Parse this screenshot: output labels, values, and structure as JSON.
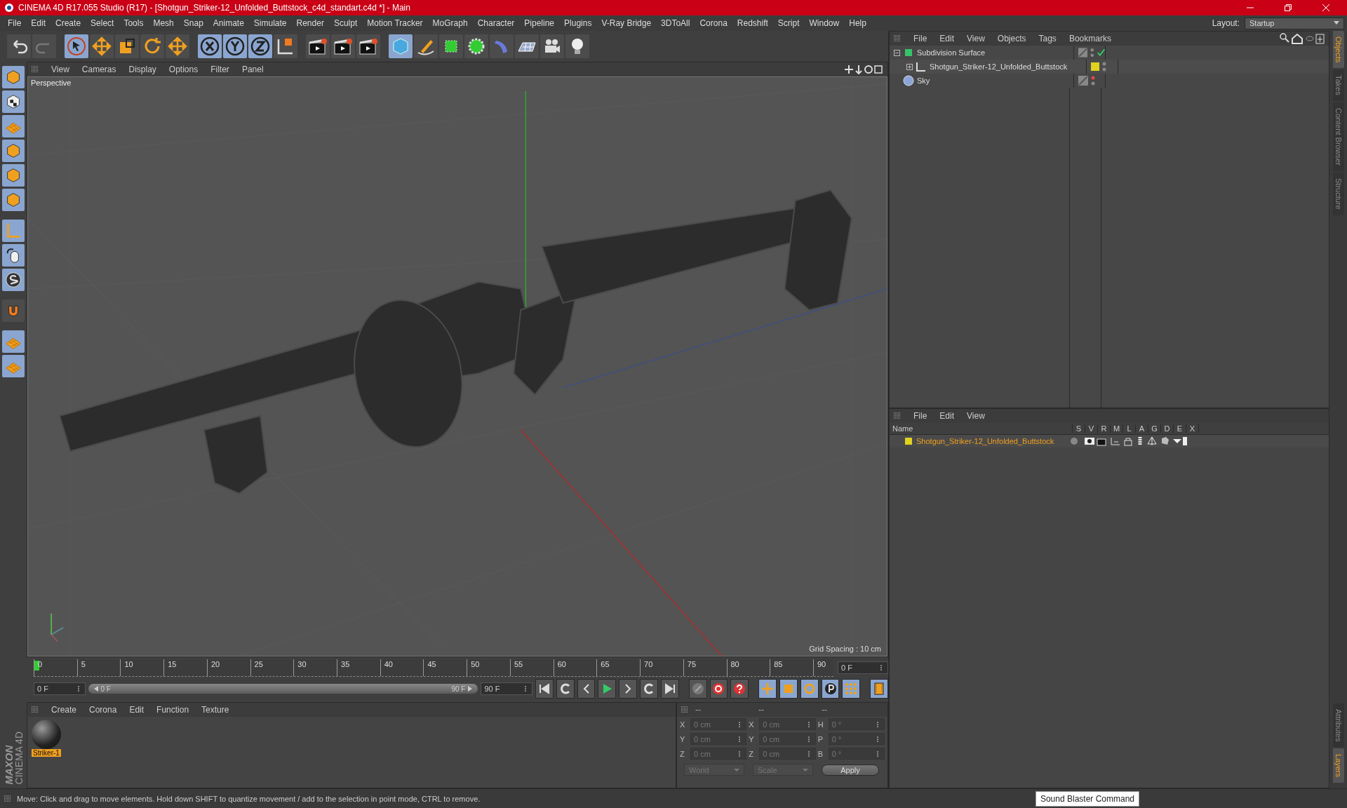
{
  "window": {
    "title": "CINEMA 4D R17.055 Studio (R17) - [Shotgun_Striker-12_Unfolded_Buttstock_c4d_standart.c4d *] - Main"
  },
  "menu": [
    "File",
    "Edit",
    "Create",
    "Select",
    "Tools",
    "Mesh",
    "Snap",
    "Animate",
    "Simulate",
    "Render",
    "Sculpt",
    "Motion Tracker",
    "MoGraph",
    "Character",
    "Pipeline",
    "Plugins",
    "V-Ray Bridge",
    "3DToAll",
    "Corona",
    "Redshift",
    "Script",
    "Window",
    "Help"
  ],
  "layout": {
    "label": "Layout:",
    "value": "Startup"
  },
  "viewport": {
    "menu": [
      "View",
      "Cameras",
      "Display",
      "Options",
      "Filter",
      "Panel"
    ],
    "camera": "Perspective",
    "grid_spacing": "Grid Spacing : 10 cm"
  },
  "timeline": {
    "ticks": [
      "0",
      "5",
      "10",
      "15",
      "20",
      "25",
      "30",
      "35",
      "40",
      "45",
      "50",
      "55",
      "60",
      "65",
      "70",
      "75",
      "80",
      "85",
      "90"
    ],
    "current_frame": "0 F",
    "start_field": "0 F",
    "range": {
      "start": "0 F",
      "end": "90 F",
      "level": 1
    },
    "end_field": "90 F"
  },
  "materials": {
    "menu": [
      "Create",
      "Corona",
      "Edit",
      "Function",
      "Texture"
    ],
    "items": [
      {
        "name": "Striker-1",
        "selected": true
      }
    ]
  },
  "coordinates": {
    "headers": [
      "--",
      "--",
      "--"
    ],
    "rows": [
      {
        "cells": [
          {
            "axis": "X",
            "value": "0 cm"
          },
          {
            "axis": "X",
            "value": "0 cm"
          },
          {
            "axis": "H",
            "value": "0 °"
          }
        ]
      },
      {
        "cells": [
          {
            "axis": "Y",
            "value": "0 cm"
          },
          {
            "axis": "Y",
            "value": "0 cm"
          },
          {
            "axis": "P",
            "value": "0 °"
          }
        ]
      },
      {
        "cells": [
          {
            "axis": "Z",
            "value": "0 cm"
          },
          {
            "axis": "Z",
            "value": "0 cm"
          },
          {
            "axis": "B",
            "value": "0 °"
          }
        ]
      }
    ],
    "space": "World",
    "mode": "Scale",
    "apply": "Apply",
    "disabled": true
  },
  "objects": {
    "menu": [
      "File",
      "Edit",
      "View",
      "Objects",
      "Tags",
      "Bookmarks"
    ],
    "tree": [
      {
        "name": "Subdivision Surface",
        "kind": "subdivision",
        "expanded": true,
        "enabled": true,
        "editor_hidden": false,
        "children": [
          {
            "name": "Shotgun_Striker-12_Unfolded_Buttstock",
            "kind": "null",
            "expanded": false,
            "editor_hidden": false,
            "color": "#e0d21e"
          }
        ]
      },
      {
        "name": "Sky",
        "kind": "sky",
        "editor_hidden": true
      }
    ]
  },
  "layers": {
    "menu": [
      "File",
      "Edit",
      "View"
    ],
    "columns": [
      "Name",
      "S",
      "V",
      "R",
      "M",
      "L",
      "A",
      "G",
      "D",
      "E",
      "X"
    ],
    "rows": [
      {
        "name": "Shotgun_Striker-12_Unfolded_Buttstock",
        "color": "#e0d21e"
      }
    ]
  },
  "side_tabs_top": [
    {
      "label": "Objects",
      "selected": true
    },
    {
      "label": "Takes",
      "selected": false
    },
    {
      "label": "Content Browser",
      "selected": false
    },
    {
      "label": "Structure",
      "selected": false
    }
  ],
  "side_tabs_bottom": [
    {
      "label": "Attributes",
      "selected": false
    },
    {
      "label": "Layers",
      "selected": true
    }
  ],
  "logo": {
    "brand": "MAXON",
    "product": "CINEMA 4D"
  },
  "status_bar": "Move: Click and drag to move elements. Hold down SHIFT to quantize movement / add to the selection in point mode, CTRL to remove.",
  "tooltip": "Sound Blaster Command"
}
